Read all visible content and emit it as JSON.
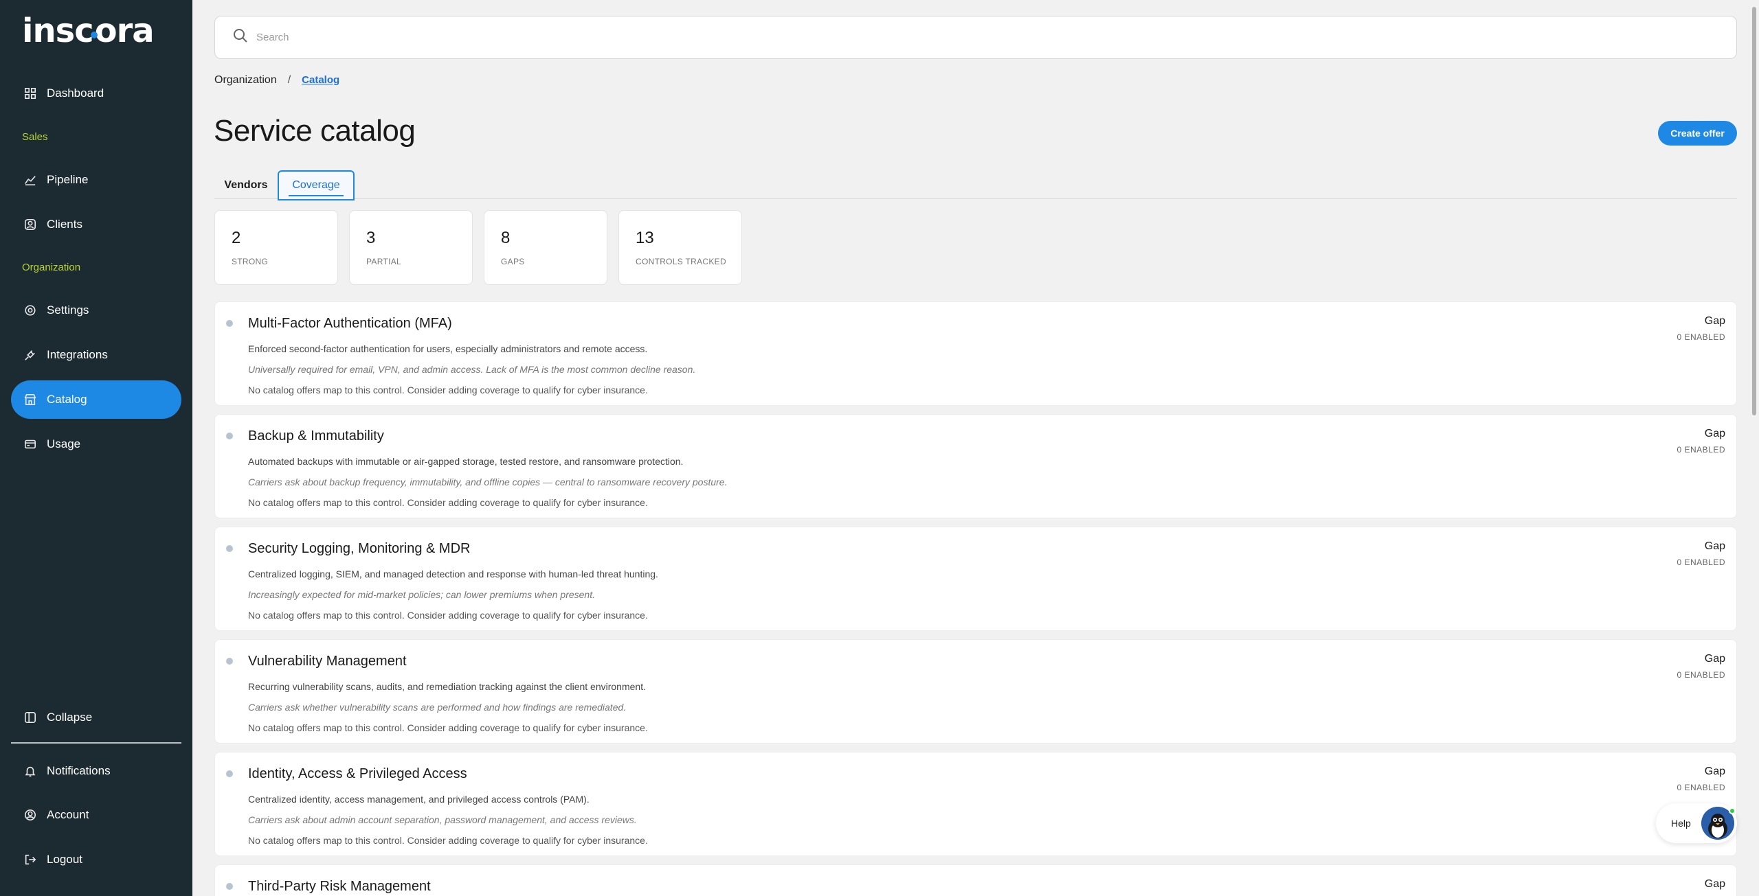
{
  "sidebar": {
    "logo": "inscora",
    "items": [
      {
        "key": "dashboard",
        "label": "Dashboard",
        "icon": "grid-icon"
      },
      {
        "key": "pipeline",
        "label": "Pipeline",
        "icon": "chart-icon"
      },
      {
        "key": "clients",
        "label": "Clients",
        "icon": "user-circle-icon"
      },
      {
        "key": "settings",
        "label": "Settings",
        "icon": "gear-icon"
      },
      {
        "key": "integrations",
        "label": "Integrations",
        "icon": "plug-icon"
      },
      {
        "key": "catalog",
        "label": "Catalog",
        "icon": "store-icon"
      },
      {
        "key": "usage",
        "label": "Usage",
        "icon": "card-icon"
      },
      {
        "key": "collapse",
        "label": "Collapse",
        "icon": "sidebar-icon"
      },
      {
        "key": "notifications",
        "label": "Notifications",
        "icon": "bell-icon"
      },
      {
        "key": "account",
        "label": "Account",
        "icon": "user-circle-icon"
      },
      {
        "key": "logout",
        "label": "Logout",
        "icon": "logout-icon"
      }
    ],
    "sections": {
      "sales": "Sales",
      "organization": "Organization"
    },
    "accent_color": "#b5d334",
    "active_color": "#1e88e5"
  },
  "search": {
    "placeholder": "Search"
  },
  "breadcrumb": {
    "root": "Organization",
    "separator": "/",
    "current": "Catalog"
  },
  "page": {
    "title": "Service catalog",
    "create_label": "Create offer"
  },
  "tabs": [
    {
      "label": "Vendors",
      "active": false
    },
    {
      "label": "Coverage",
      "active": true
    }
  ],
  "stats": [
    {
      "value": "2",
      "label": "STRONG"
    },
    {
      "value": "3",
      "label": "PARTIAL"
    },
    {
      "value": "8",
      "label": "GAPS"
    },
    {
      "value": "13",
      "label": "CONTROLS TRACKED"
    }
  ],
  "controls": [
    {
      "title": "Multi-Factor Authentication (MFA)",
      "description": "Enforced second-factor authentication for users, especially administrators and remote access.",
      "note": "Universally required for email, VPN, and admin access. Lack of MFA is the most common decline reason.",
      "message": "No catalog offers map to this control. Consider adding coverage to qualify for cyber insurance.",
      "status": "Gap",
      "enabled": "0 ENABLED"
    },
    {
      "title": "Backup & Immutability",
      "description": "Automated backups with immutable or air-gapped storage, tested restore, and ransomware protection.",
      "note": "Carriers ask about backup frequency, immutability, and offline copies — central to ransomware recovery posture.",
      "message": "No catalog offers map to this control. Consider adding coverage to qualify for cyber insurance.",
      "status": "Gap",
      "enabled": "0 ENABLED"
    },
    {
      "title": "Security Logging, Monitoring & MDR",
      "description": "Centralized logging, SIEM, and managed detection and response with human-led threat hunting.",
      "note": "Increasingly expected for mid-market policies; can lower premiums when present.",
      "message": "No catalog offers map to this control. Consider adding coverage to qualify for cyber insurance.",
      "status": "Gap",
      "enabled": "0 ENABLED"
    },
    {
      "title": "Vulnerability Management",
      "description": "Recurring vulnerability scans, audits, and remediation tracking against the client environment.",
      "note": "Carriers ask whether vulnerability scans are performed and how findings are remediated.",
      "message": "No catalog offers map to this control. Consider adding coverage to qualify for cyber insurance.",
      "status": "Gap",
      "enabled": "0 ENABLED"
    },
    {
      "title": "Identity, Access & Privileged Access",
      "description": "Centralized identity, access management, and privileged access controls (PAM).",
      "note": "Carriers ask about admin account separation, password management, and access reviews.",
      "message": "No catalog offers map to this control. Consider adding coverage to qualify for cyber insurance.",
      "status": "Gap",
      "enabled": "0 ENABLED"
    },
    {
      "title": "Third-Party Risk Management",
      "description": "",
      "note": "",
      "message": "",
      "status": "Gap",
      "enabled": ""
    }
  ],
  "help": {
    "label": "Help"
  }
}
